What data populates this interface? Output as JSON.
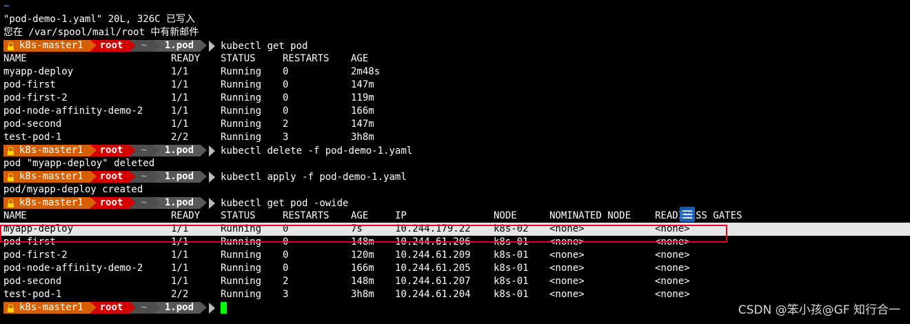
{
  "terminal": {
    "tilde": "~",
    "vim_status": "\"pod-demo-1.yaml\" 20L, 326C 已写入",
    "mail_notice": "您在 /var/spool/mail/root 中有新邮件",
    "prompt": {
      "host": "k8s-master1",
      "user": "root",
      "home": "~",
      "dir": "1.pod"
    },
    "commands": {
      "get_pod": "kubectl get pod",
      "delete": "kubectl delete -f pod-demo-1.yaml",
      "apply": "kubectl apply -f pod-demo-1.yaml",
      "get_wide": "kubectl get pod -owide"
    },
    "outputs": {
      "deleted": "pod \"myapp-deploy\" deleted",
      "created": "pod/myapp-deploy created"
    },
    "table1": {
      "headers": [
        "NAME",
        "READY",
        "STATUS",
        "RESTARTS",
        "AGE"
      ],
      "rows": [
        [
          "myapp-deploy",
          "1/1",
          "Running",
          "0",
          "2m48s"
        ],
        [
          "pod-first",
          "1/1",
          "Running",
          "0",
          "147m"
        ],
        [
          "pod-first-2",
          "1/1",
          "Running",
          "0",
          "119m"
        ],
        [
          "pod-node-affinity-demo-2",
          "1/1",
          "Running",
          "0",
          "166m"
        ],
        [
          "pod-second",
          "1/1",
          "Running",
          "2",
          "147m"
        ],
        [
          "test-pod-1",
          "2/2",
          "Running",
          "3",
          "3h8m"
        ]
      ]
    },
    "table2": {
      "headers": [
        "NAME",
        "READY",
        "STATUS",
        "RESTARTS",
        "AGE",
        "IP",
        "NODE",
        "NOMINATED NODE",
        "READINESS GATES"
      ],
      "rows": [
        [
          "myapp-deploy",
          "1/1",
          "Running",
          "0",
          "7s",
          "10.244.179.22",
          "k8s-02",
          "<none>",
          "<none>"
        ],
        [
          "pod-first",
          "1/1",
          "Running",
          "0",
          "148m",
          "10.244.61.206",
          "k8s-01",
          "<none>",
          "<none>"
        ],
        [
          "pod-first-2",
          "1/1",
          "Running",
          "0",
          "120m",
          "10.244.61.209",
          "k8s-01",
          "<none>",
          "<none>"
        ],
        [
          "pod-node-affinity-demo-2",
          "1/1",
          "Running",
          "0",
          "166m",
          "10.244.61.205",
          "k8s-01",
          "<none>",
          "<none>"
        ],
        [
          "pod-second",
          "1/1",
          "Running",
          "2",
          "148m",
          "10.244.61.207",
          "k8s-01",
          "<none>",
          "<none>"
        ],
        [
          "test-pod-1",
          "2/2",
          "Running",
          "3",
          "3h8m",
          "10.244.61.204",
          "k8s-01",
          "<none>",
          "<none>"
        ]
      ]
    }
  },
  "watermark": "CSDN @笨小孩@GF 知行合一",
  "colors": {
    "host_segment": "#d75f00",
    "user_segment": "#d70000",
    "dir_segment": "#585858",
    "highlight_box": "#e4001f",
    "selected_row_bg": "#e6e6e6",
    "cursor": "#00ff00"
  }
}
